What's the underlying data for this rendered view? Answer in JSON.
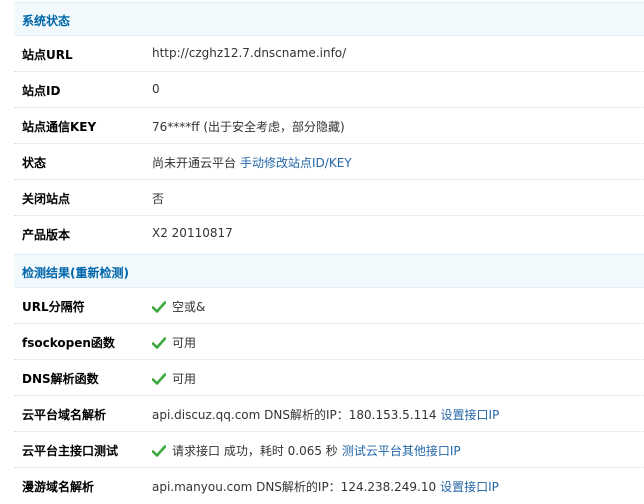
{
  "system_status": {
    "header": "系统状态",
    "rows": [
      {
        "label": "站点URL",
        "value": "http://czghz12.7.dnscname.info/"
      },
      {
        "label": "站点ID",
        "value": "0"
      },
      {
        "label": "站点通信KEY",
        "value": "76****ff (出于安全考虑，部分隐藏)"
      },
      {
        "label": "状态",
        "value": "尚未开通云平台",
        "link": "手动修改站点ID/KEY"
      },
      {
        "label": "关闭站点",
        "value": "否"
      },
      {
        "label": "产品版本",
        "value": "X2 20110817"
      }
    ]
  },
  "check_results": {
    "header": "检测结果(重新检测)",
    "rows": [
      {
        "label": "URL分隔符",
        "value": "空或&"
      },
      {
        "label": "fsockopen函数",
        "value": "可用"
      },
      {
        "label": "DNS解析函数",
        "value": "可用"
      },
      {
        "label": "云平台域名解析",
        "value": "api.discuz.qq.com DNS解析的IP：180.153.5.114",
        "link": "设置接口IP"
      },
      {
        "label": "云平台主接口测试",
        "value": "请求接口 成功，耗时 0.065 秒",
        "link": "测试云平台其他接口IP"
      },
      {
        "label": "漫游域名解析",
        "value": "api.manyou.com DNS解析的IP：124.238.249.10",
        "link": "设置接口IP"
      }
    ]
  },
  "colors": {
    "header_bg": "#f2f9fd",
    "header_text": "#0066aa",
    "link": "#2366a8",
    "check": "#3aa83a"
  },
  "icons": {
    "status_ok": "check-icon"
  }
}
